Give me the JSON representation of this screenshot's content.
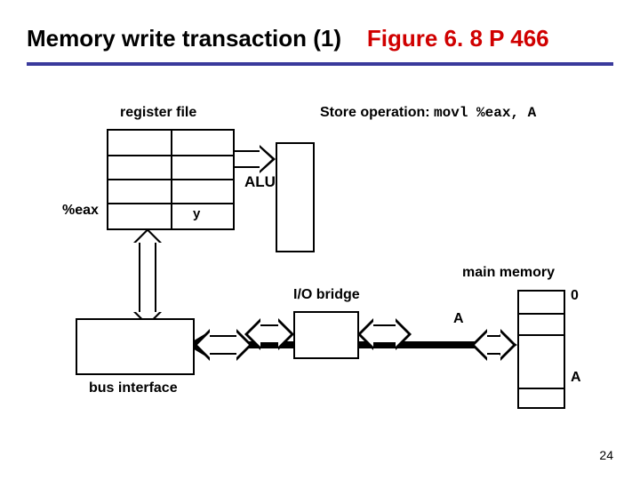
{
  "title_part1": "Memory write transaction (1)",
  "title_part2": "Figure 6. 8 P 466",
  "labels": {
    "register_file": "register file",
    "store_op_prefix": "Store operation:",
    "store_op_code": "movl %eax, A",
    "eax": "%eax",
    "y": "y",
    "alu": "ALU",
    "io_bridge": "I/O bridge",
    "bus_interface": "bus interface",
    "main_memory": "main memory",
    "mem_addr0": "0",
    "mem_addrA_inside": "A",
    "mem_addrA_outside": "A"
  },
  "page_number": "24"
}
